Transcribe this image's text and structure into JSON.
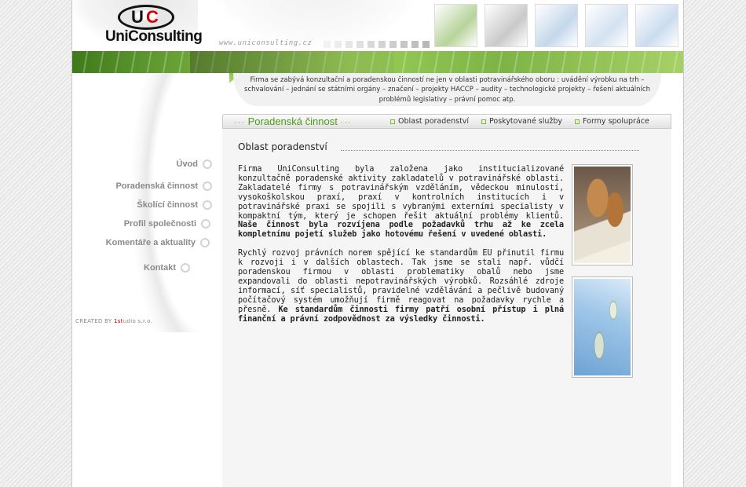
{
  "brand": {
    "logo_letters_u": "U",
    "logo_letters_c": "C",
    "name": "UniConsulting",
    "url": "www.uniconsulting.cz"
  },
  "colors": {
    "accent_green": "#4f9a16",
    "logo_red": "#d40000",
    "nav_gray": "#8a8a8a"
  },
  "header_dots": [
    "#f2f2f2",
    "#ececec",
    "#e6e6e6",
    "#e0e0e0",
    "#d9d9d9",
    "#d3d3d3",
    "#cdcdcd",
    "#c6c6c6",
    "#bfbfbf",
    "#b8b8b8"
  ],
  "header_thumbs": [
    {
      "name": "thumb-leaf",
      "color": "#b7d39a"
    },
    {
      "name": "thumb-hand",
      "color": "#c9c9c9"
    },
    {
      "name": "thumb-blue-1",
      "color": "#c5d8ec"
    },
    {
      "name": "thumb-blue-2",
      "color": "#d4e2f1"
    },
    {
      "name": "thumb-blue-3",
      "color": "#cbdcef"
    }
  ],
  "intro": {
    "text": "Firma se zabývá konzultační a poradenskou činností ne jen v oblasti potravinářského oboru : uvádění výrobku na trh – schvalování – jednání se státními orgány – značení – projekty HACCP – audity – technologické projekty – řešení aktuálních problémů legislativy – právní pomoc atp."
  },
  "nav": {
    "items": [
      {
        "label": "Úvod"
      },
      {
        "label": "Poradenská činnost"
      },
      {
        "label": "Školící činnost"
      },
      {
        "label": "Profil společnosti"
      },
      {
        "label": "Komentáře a aktuality"
      },
      {
        "label": "Kontakt"
      }
    ]
  },
  "credit": {
    "prefix": "CREATED BY ",
    "brand_1": "1st",
    "brand_2": "udio s.r.o."
  },
  "tabs": {
    "active": "Poradenská činnost",
    "active_prefix": "···",
    "active_suffix": "···",
    "links": [
      {
        "label": "Oblast poradenství"
      },
      {
        "label": "Poskytované služby"
      },
      {
        "label": "Formy spolupráce"
      }
    ]
  },
  "content": {
    "title": "Oblast poradenství",
    "p1_normal": "Firma UniConsulting byla založena jako institucializované konzultačně poradenské aktivity zakladatelů v potravinářské oblasti. Zakladatelé firmy s potravinářským vzděláním, vědeckou minulostí, vysokoškolskou praxí, praxí v kontrolních institucích i v potravinářské praxi se spojili s vybranými externími specialisty v kompaktní tým, který je schopen řešit aktuální problémy klientů. ",
    "p1_bold": "Naše činnost byla rozvíjena podle požadavků trhu až ke zcela kompletnímu pojetí služeb jako hotovému řešení v uvedené oblasti.",
    "p2_normal": "Rychlý rozvoj právních norem spějící ke standardům EU přinutil firmu k rozvoji i v dalších oblastech. Tak jsme se stali např. vůdčí poradenskou firmou v oblasti problematiky obalů nebo jsme expandovali do oblasti nepotravinářských výrobků. Rozsáhlé zdroje informací, síť specialistů, pravidelné vzdělávání a pečlivě budovaný počítačový systém umožňují firmě reagovat na požadavky rychle a přesně. ",
    "p2_bold": "Ke standardům činnosti firmy patří osobní přístup i plná finanční a právní zodpovědnost za výsledky činnosti."
  }
}
